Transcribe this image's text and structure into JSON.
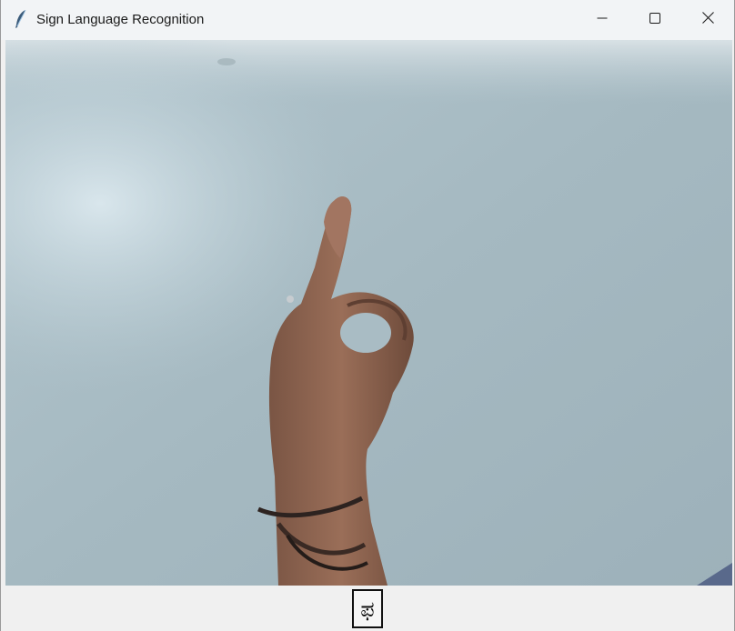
{
  "window": {
    "title": "Sign Language Recognition",
    "icons": {
      "app": "feather-icon",
      "minimize": "minimize-icon",
      "maximize": "maximize-icon",
      "close": "close-icon"
    }
  },
  "camera_feed": {
    "content": "webcam-frame-hand-sign"
  },
  "prediction": {
    "character": "ಫ"
  },
  "colors": {
    "titlebar": "#f2f4f6",
    "window_bg": "#f0f0f0",
    "feed_bg": "#a9bcc4"
  }
}
